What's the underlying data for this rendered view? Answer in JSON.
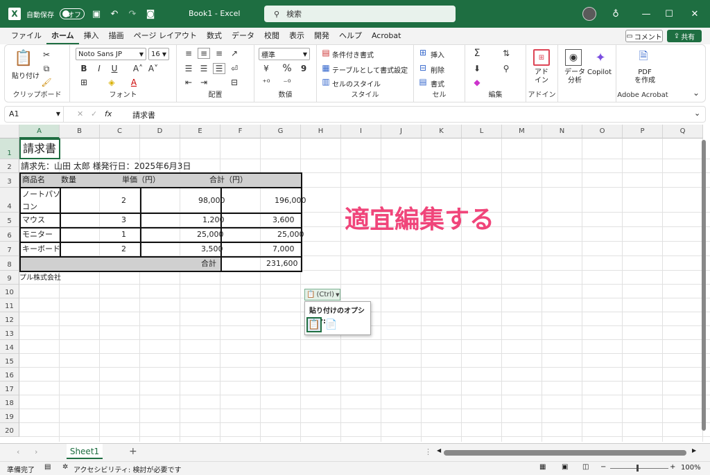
{
  "titlebar": {
    "app_logo": "X",
    "autosave_label": "自動保存",
    "autosave_state": "オフ",
    "doc_title": "Book1 - Excel",
    "search_placeholder": "検索",
    "icons": [
      "save-icon",
      "undo-icon",
      "redo-icon",
      "screenshot-icon",
      "lightbulb-icon"
    ]
  },
  "menu": {
    "tabs": [
      "ファイル",
      "ホーム",
      "挿入",
      "描画",
      "ページ レイアウト",
      "数式",
      "データ",
      "校閲",
      "表示",
      "開発",
      "ヘルプ",
      "Acrobat"
    ],
    "active": "ホーム",
    "comment_label": "コメント",
    "share_label": "共有"
  },
  "ribbon": {
    "clipboard": {
      "label": "クリップボード",
      "paste": "貼り付け"
    },
    "font": {
      "label": "フォント",
      "name": "Noto Sans JP",
      "size": "16",
      "bold": "B",
      "italic": "I",
      "underline": "U"
    },
    "alignment": {
      "label": "配置"
    },
    "number": {
      "label": "数値",
      "format": "標準",
      "percent": "%",
      "comma": "9"
    },
    "styles": {
      "label": "スタイル",
      "conditional": "条件付き書式",
      "table": "テーブルとして書式設定",
      "cell": "セルのスタイル"
    },
    "cells": {
      "label": "セル",
      "insert": "挿入",
      "delete": "削除",
      "format": "書式"
    },
    "editing": {
      "label": "編集"
    },
    "addins": {
      "label": "アドイン",
      "button": "アド\nイン"
    },
    "data_analysis": "データ\n分析",
    "copilot": "Copilot",
    "acrobat": {
      "label": "Adobe Acrobat",
      "button": "PDF\nを作成"
    }
  },
  "formula_bar": {
    "name_box": "A1",
    "fx": "fx",
    "content": "請求書"
  },
  "columns": [
    "A",
    "B",
    "C",
    "D",
    "E",
    "F",
    "G",
    "H",
    "I",
    "J",
    "K",
    "L",
    "M",
    "N",
    "O",
    "P",
    "Q"
  ],
  "rows": [
    "1",
    "2",
    "3",
    "4",
    "5",
    "6",
    "7",
    "8",
    "9",
    "10",
    "11",
    "12",
    "13",
    "14",
    "15",
    "16",
    "17",
    "18",
    "19",
    "20"
  ],
  "sheet": {
    "title": "請求書",
    "recipient": "請求先：山田 太郎 様発行日：2025年6月3日",
    "headers": [
      "商品名",
      "数量",
      "単価（円）",
      "合計（円）"
    ],
    "items": [
      {
        "name_line1": "ノートパソ",
        "name_line2": "コン",
        "qty": "2",
        "price": "98,000",
        "total": "196,000"
      },
      {
        "name": "マウス",
        "qty": "3",
        "price": "1,200",
        "total": "3,600"
      },
      {
        "name": "モニター",
        "qty": "1",
        "price": "25,000",
        "total": "25,000"
      },
      {
        "name": "キーボード",
        "qty": "2",
        "price": "3,500",
        "total": "7,000"
      }
    ],
    "sum_label": "合計",
    "sum_value": "231,600",
    "company": "プル株式会社"
  },
  "paste_options": {
    "ctrl_label": "(Ctrl)",
    "title": "貼り付けのオプション:"
  },
  "annotation": "適宜編集する",
  "sheet_tabs": {
    "active": "Sheet1",
    "add": "+"
  },
  "status": {
    "ready": "準備完了",
    "accessibility": "アクセシビリティ: 検討が必要です",
    "zoom": "100%"
  },
  "colors": {
    "excel_green": "#1e6e41",
    "annotation_pink": "#f0457a"
  }
}
